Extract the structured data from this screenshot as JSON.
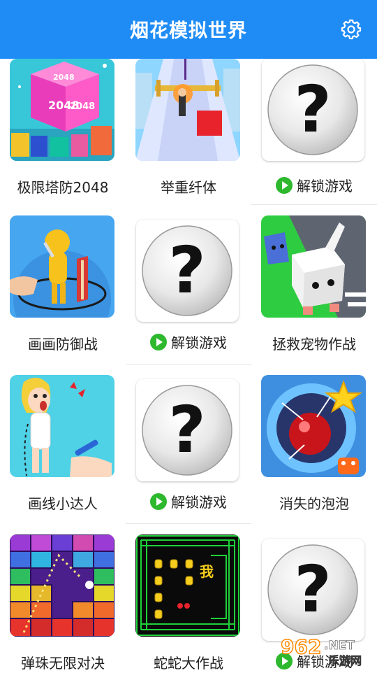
{
  "header": {
    "title": "烟花模拟世界",
    "settings_icon": "gear-icon"
  },
  "unlock_label": "解锁游戏",
  "games": [
    {
      "name": "极限塔防2048",
      "locked": false,
      "thumb": "cube-2048",
      "cube_text": "2048"
    },
    {
      "name": "举重纤体",
      "locked": false,
      "thumb": "runner"
    },
    {
      "name": "",
      "locked": true
    },
    {
      "name": "画画防御战",
      "locked": false,
      "thumb": "sword-hero"
    },
    {
      "name": "",
      "locked": true
    },
    {
      "name": "拯救宠物作战",
      "locked": false,
      "thumb": "pets"
    },
    {
      "name": "画线小达人",
      "locked": false,
      "thumb": "drawing-girl"
    },
    {
      "name": "",
      "locked": true
    },
    {
      "name": "消失的泡泡",
      "locked": false,
      "thumb": "bubble"
    },
    {
      "name": "弹珠无限对决",
      "locked": false,
      "thumb": "bricks"
    },
    {
      "name": "蛇蛇大作战",
      "locked": false,
      "thumb": "snake",
      "snake_char": "我"
    },
    {
      "name": "",
      "locked": true
    }
  ],
  "watermark": {
    "num": "962",
    "tld": ".NET",
    "sub": "乐游网"
  },
  "colors": {
    "header": "#1f8cf6",
    "play_green": "#2db82d"
  }
}
